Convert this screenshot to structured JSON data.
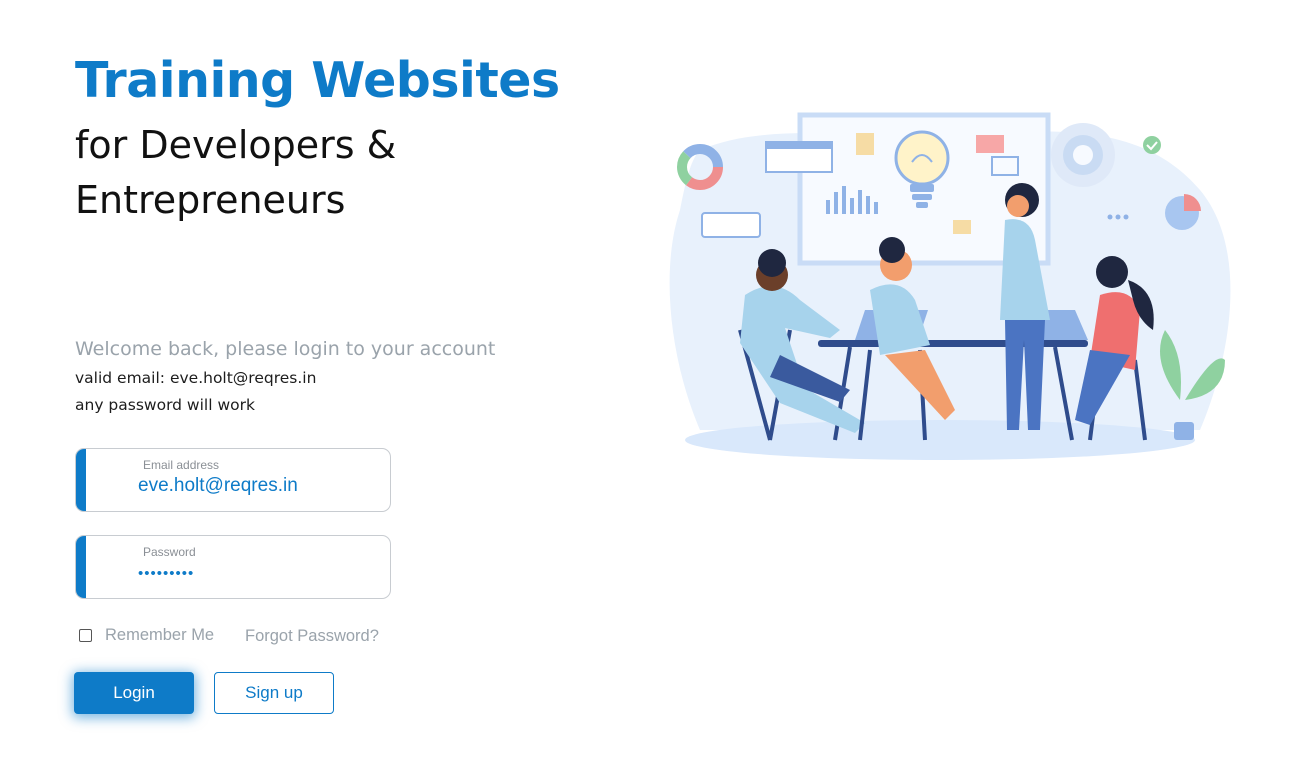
{
  "header": {
    "title": "Training Websites",
    "subtitle": "for Developers & Entrepreneurs"
  },
  "login": {
    "welcome": "Welcome back, please login to your account",
    "hint_email": "valid email: eve.holt@reqres.in",
    "hint_password": "any password will work",
    "email_label": "Email address",
    "email_value": "eve.holt@reqres.in",
    "password_label": "Password",
    "password_value": "•••••••••",
    "remember_label": "Remember Me",
    "forgot_label": "Forgot Password?",
    "login_button": "Login",
    "signup_button": "Sign up"
  },
  "illustration": {
    "subject": "team-meeting-illustration"
  },
  "colors": {
    "accent": "#0e7bc8",
    "muted_text": "#9aa3ab",
    "body_text": "#111111"
  }
}
